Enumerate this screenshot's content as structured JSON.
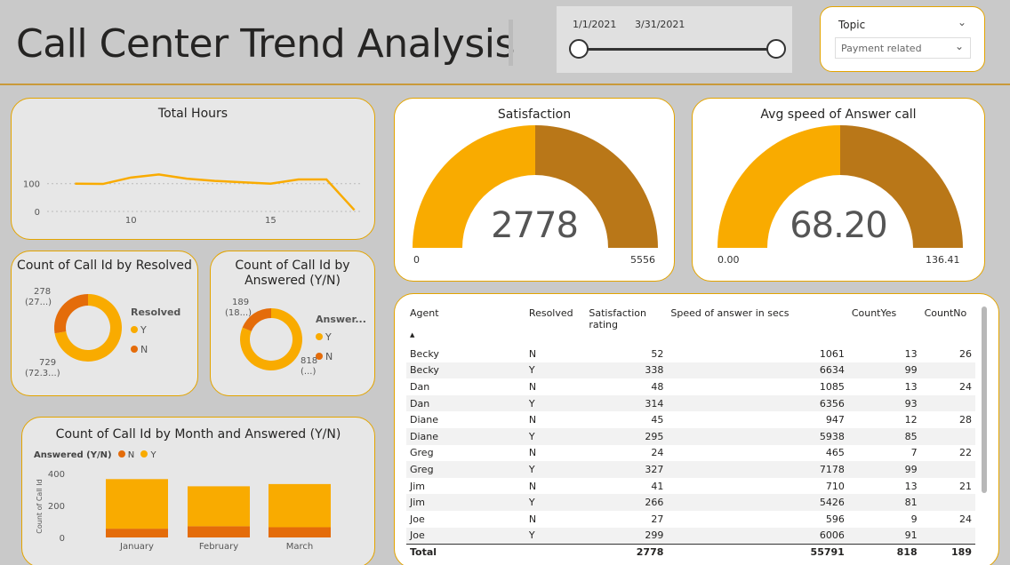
{
  "header": {
    "title": "Call Center Trend Analysis",
    "date_start": "1/1/2021",
    "date_end": "3/31/2021",
    "topic_label": "Topic",
    "topic_value": "Payment related"
  },
  "colors": {
    "accent": "#F9AB00",
    "dark": "#B97718",
    "orange": "#E46C0A",
    "border": "#E3A400"
  },
  "total_hours": {
    "title": "Total Hours",
    "chart_data": {
      "type": "line",
      "x": [
        8,
        9,
        10,
        11,
        12,
        13,
        14,
        15,
        16,
        17,
        18,
        19
      ],
      "values": [
        100,
        99,
        122,
        133,
        118,
        110,
        100,
        115,
        115,
        5
      ],
      "x_points": [
        8,
        9,
        10,
        11,
        12,
        13,
        15,
        16,
        17,
        18
      ],
      "yticks": [
        "100",
        "0"
      ],
      "xticks": [
        "10",
        "15"
      ]
    }
  },
  "satisfaction": {
    "title": "Satisfaction",
    "value": "2778",
    "min": "0",
    "max": "5556",
    "fraction": 0.5
  },
  "speed": {
    "title": "Avg speed of Answer call",
    "value": "68.20",
    "min": "0.00",
    "max": "136.41",
    "fraction": 0.5
  },
  "resolved": {
    "title": "Count of Call Id by Resolved",
    "legend_title": "Resolved",
    "legend": [
      "Y",
      "N"
    ],
    "label_n": "278",
    "label_n_sub": "(27...)",
    "label_y": "729",
    "label_y_sub": "(72.3...)",
    "chart_data": {
      "type": "pie",
      "categories": [
        "Y",
        "N"
      ],
      "values": [
        729,
        278
      ]
    }
  },
  "answered": {
    "title": "Count of Call Id by Answered (Y/N)",
    "legend_title": "Answer...",
    "legend": [
      "Y",
      "N"
    ],
    "label_n": "189",
    "label_n_sub": "(18...)",
    "label_y": "818",
    "label_y_sub": "(...)",
    "chart_data": {
      "type": "pie",
      "categories": [
        "Y",
        "N"
      ],
      "values": [
        818,
        189
      ]
    }
  },
  "month_chart": {
    "title": "Count of Call Id by Month and Answered (Y/N)",
    "legend_title": "Answered (Y/N)",
    "legend": [
      "N",
      "Y"
    ],
    "ylabel": "Count of Call Id",
    "yticks": [
      "400",
      "200",
      "0"
    ],
    "chart_data": {
      "type": "bar",
      "categories": [
        "January",
        "February",
        "March"
      ],
      "series": [
        {
          "name": "N",
          "values": [
            55,
            70,
            64
          ]
        },
        {
          "name": "Y",
          "values": [
            310,
            250,
            270
          ]
        }
      ],
      "ylim": [
        0,
        400
      ]
    }
  },
  "table": {
    "headers": [
      "Agent",
      "Resolved",
      "Satisfaction rating",
      "Speed of answer in secs",
      "CountYes",
      "CountNo"
    ],
    "rows": [
      [
        "Becky",
        "N",
        "52",
        "1061",
        "13",
        "26"
      ],
      [
        "Becky",
        "Y",
        "338",
        "6634",
        "99",
        ""
      ],
      [
        "Dan",
        "N",
        "48",
        "1085",
        "13",
        "24"
      ],
      [
        "Dan",
        "Y",
        "314",
        "6356",
        "93",
        ""
      ],
      [
        "Diane",
        "N",
        "45",
        "947",
        "12",
        "28"
      ],
      [
        "Diane",
        "Y",
        "295",
        "5938",
        "85",
        ""
      ],
      [
        "Greg",
        "N",
        "24",
        "465",
        "7",
        "22"
      ],
      [
        "Greg",
        "Y",
        "327",
        "7178",
        "99",
        ""
      ],
      [
        "Jim",
        "N",
        "41",
        "710",
        "13",
        "21"
      ],
      [
        "Jim",
        "Y",
        "266",
        "5426",
        "81",
        ""
      ],
      [
        "Joe",
        "N",
        "27",
        "596",
        "9",
        "24"
      ],
      [
        "Joe",
        "Y",
        "299",
        "6006",
        "91",
        ""
      ]
    ],
    "total": [
      "Total",
      "",
      "2778",
      "55791",
      "818",
      "189"
    ]
  }
}
